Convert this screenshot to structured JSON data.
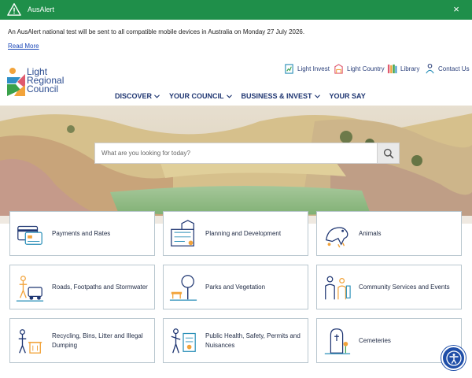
{
  "alert": {
    "title": "AusAlert",
    "close": "×",
    "message": "An AusAlert national test will be sent to all compatible mobile devices in Australia on Monday 27 July 2026.",
    "read_more": "Read More",
    "bar_color": "#1f8f4a"
  },
  "logo": {
    "line1": "Light",
    "line2": "Regional",
    "line3": "Council"
  },
  "top_links": [
    {
      "label": "Light Invest",
      "icon": "light-invest-icon"
    },
    {
      "label": "Light Country",
      "icon": "light-country-icon"
    },
    {
      "label": "Library",
      "icon": "library-icon"
    },
    {
      "label": "Contact Us",
      "icon": "contact-icon"
    }
  ],
  "nav": [
    {
      "label": "DISCOVER",
      "has_menu": true
    },
    {
      "label": "YOUR COUNCIL",
      "has_menu": true
    },
    {
      "label": "BUSINESS & INVEST",
      "has_menu": true
    },
    {
      "label": "YOUR SAY",
      "has_menu": false
    }
  ],
  "search": {
    "placeholder": "What are you looking for today?",
    "icon": "search-icon"
  },
  "tiles": [
    {
      "label": "Payments and Rates",
      "icon": "payments-icon"
    },
    {
      "label": "Planning and Development",
      "icon": "planning-icon"
    },
    {
      "label": "Animals",
      "icon": "animals-icon"
    },
    {
      "label": "Roads, Footpaths and Stormwater",
      "icon": "roads-icon"
    },
    {
      "label": "Parks and Vegetation",
      "icon": "parks-icon"
    },
    {
      "label": "Community Services and Events",
      "icon": "community-icon"
    },
    {
      "label": "Recycling, Bins, Litter and Illegal Dumping",
      "icon": "recycling-icon"
    },
    {
      "label": "Public Health, Safety, Permits and Nuisances",
      "icon": "public-health-icon"
    },
    {
      "label": "Cemeteries",
      "icon": "cemeteries-icon"
    }
  ],
  "accessibility": {
    "icon": "accessibility-icon",
    "color": "#1f4ea8"
  }
}
